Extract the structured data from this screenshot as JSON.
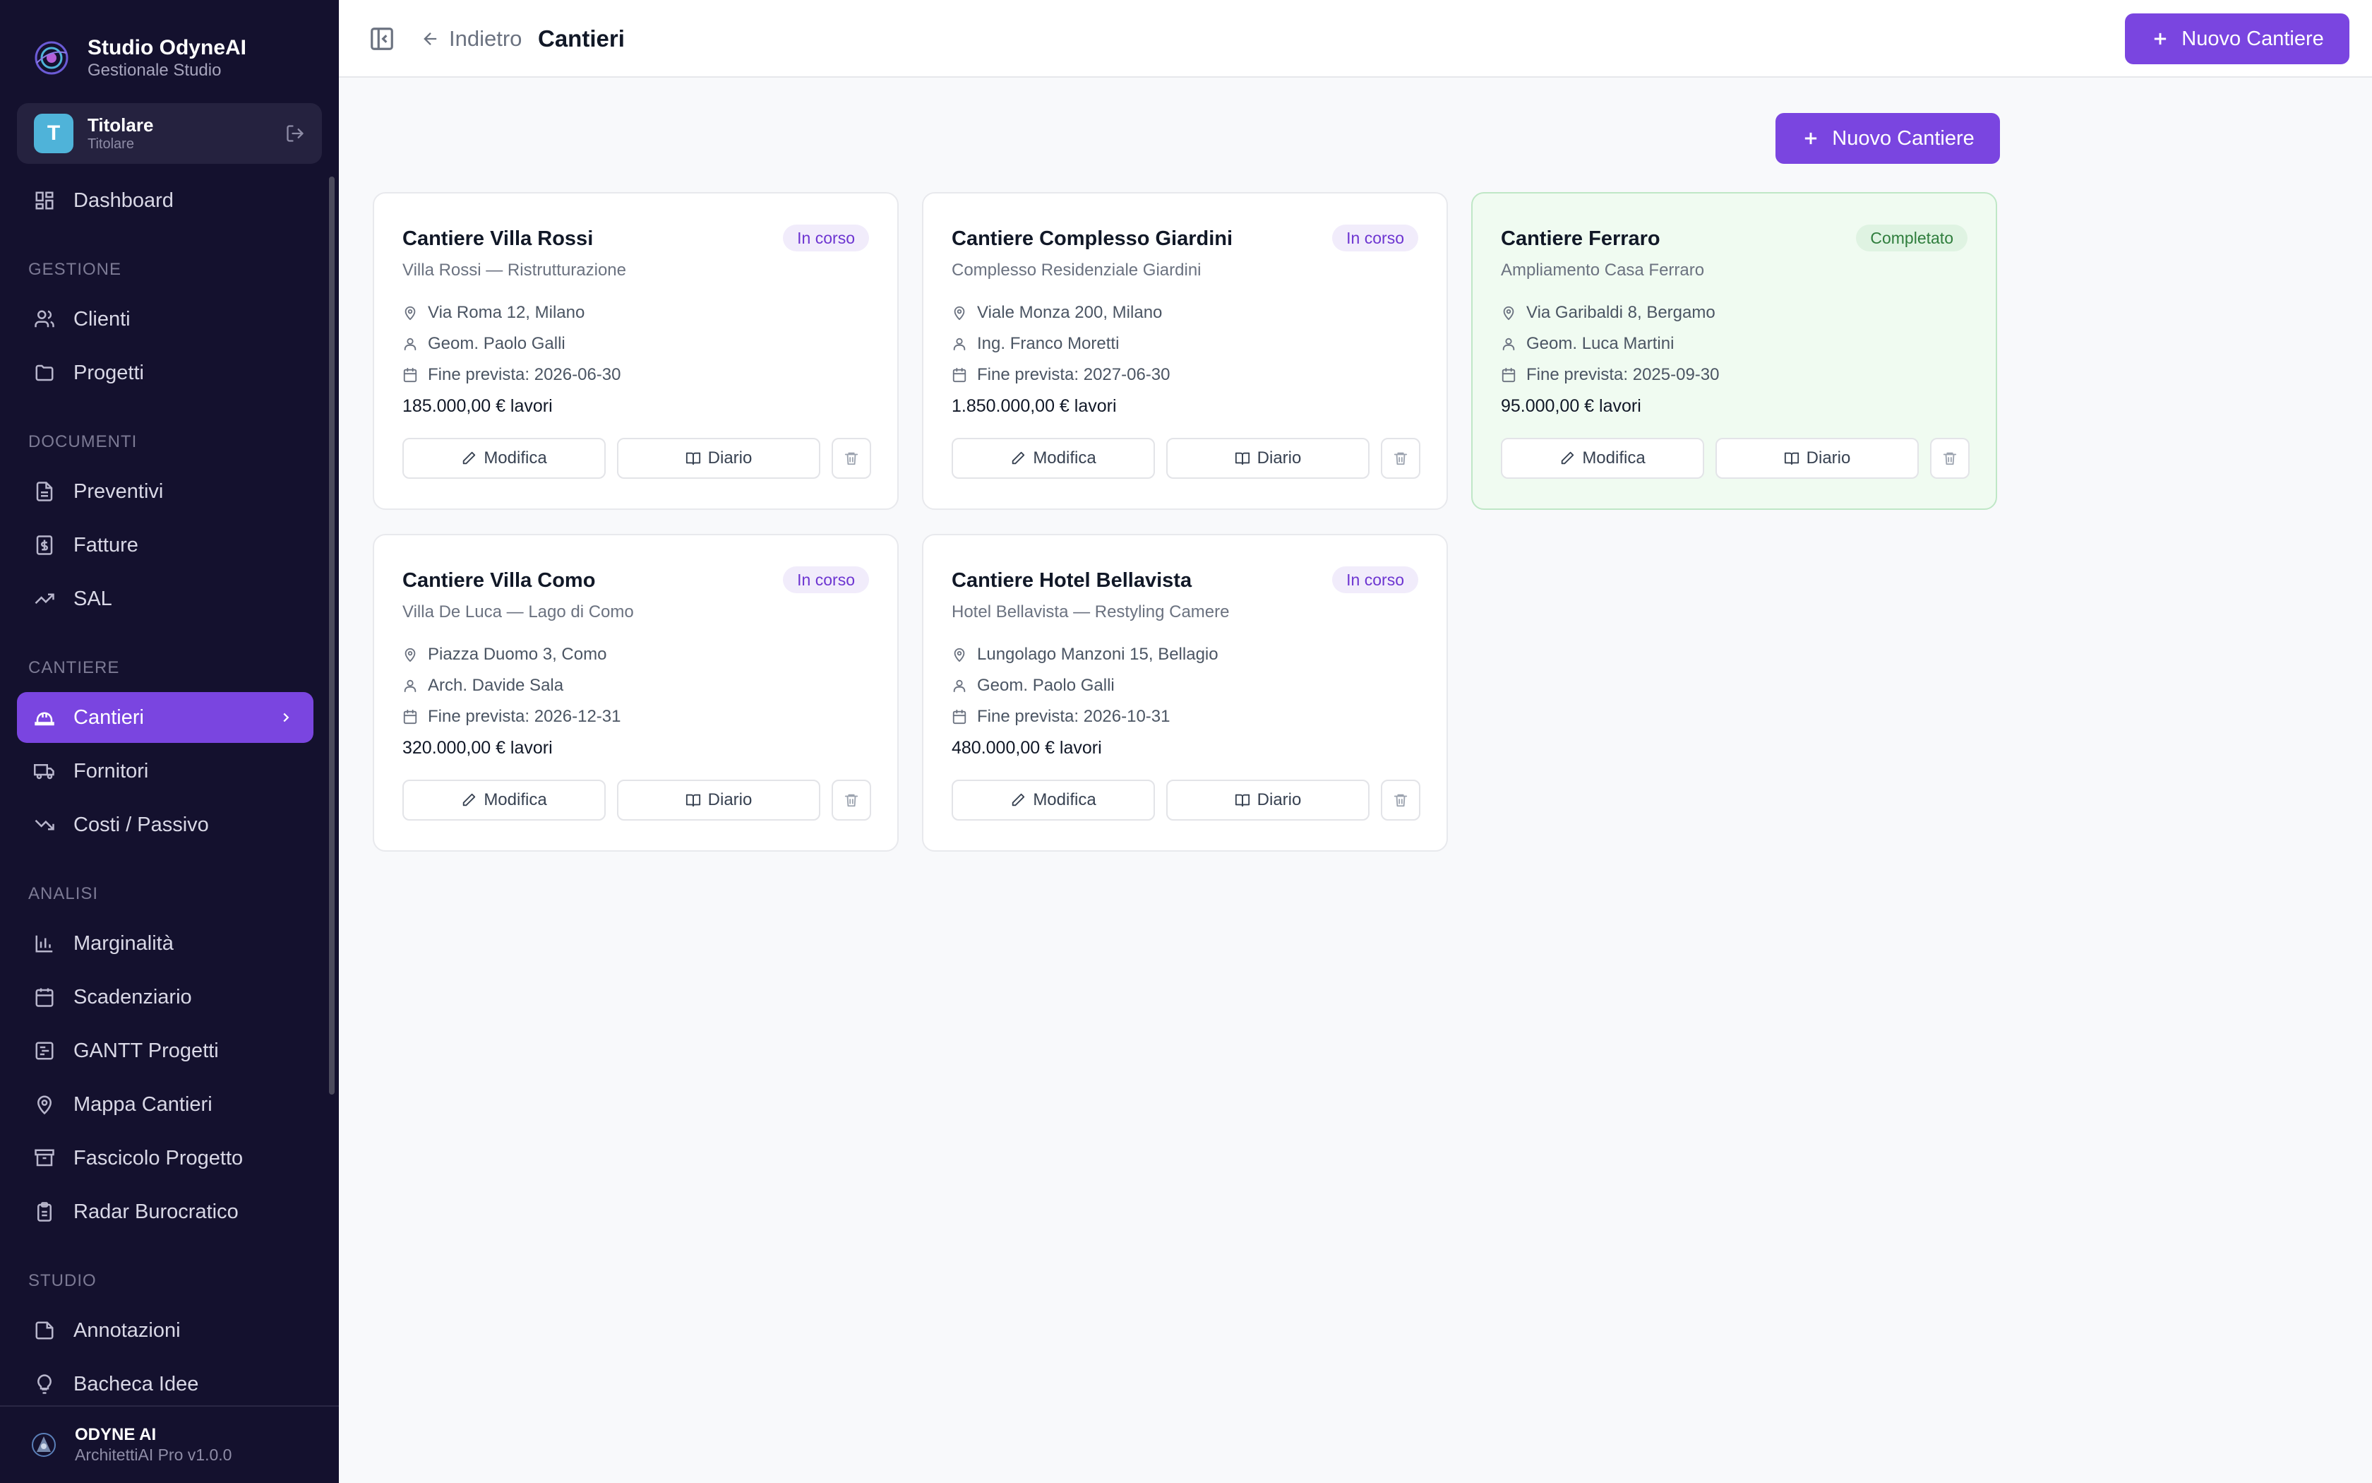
{
  "sidebar": {
    "brand_name": "Studio OdyneAI",
    "brand_sub": "Gestionale Studio",
    "user": {
      "initial": "T",
      "name": "Titolare",
      "role": "Titolare"
    },
    "dashboard": "Dashboard",
    "sections": {
      "gestione": "GESTIONE",
      "documenti": "DOCUMENTI",
      "cantiere": "CANTIERE",
      "analisi": "ANALISI",
      "studio": "STUDIO"
    },
    "items": {
      "clienti": "Clienti",
      "progetti": "Progetti",
      "preventivi": "Preventivi",
      "fatture": "Fatture",
      "sal": "SAL",
      "cantieri": "Cantieri",
      "fornitori": "Fornitori",
      "costi": "Costi / Passivo",
      "marginalita": "Marginalità",
      "scadenziario": "Scadenziario",
      "gantt": "GANTT Progetti",
      "mappa": "Mappa Cantieri",
      "fascicolo": "Fascicolo Progetto",
      "radar": "Radar Burocratico",
      "annotazioni": "Annotazioni",
      "bacheca": "Bacheca Idee"
    },
    "footer": {
      "name": "ODYNE AI",
      "version": "ArchitettiAI Pro v1.0.0"
    }
  },
  "header": {
    "back_label": "Indietro",
    "title": "Cantieri",
    "new_button": "Nuovo Cantiere"
  },
  "main": {
    "new_button": "Nuovo Cantiere",
    "labels": {
      "edit": "Modifica",
      "diary": "Diario"
    },
    "cards": [
      {
        "title": "Cantiere Villa Rossi",
        "status": "In corso",
        "subtitle": "Villa Rossi — Ristrutturazione",
        "address": "Via Roma 12, Milano",
        "manager": "Geom. Paolo Galli",
        "end": "Fine prevista: 2026-06-30",
        "amount": "185.000,00 € lavori"
      },
      {
        "title": "Cantiere Complesso Giardini",
        "status": "In corso",
        "subtitle": "Complesso Residenziale Giardini",
        "address": "Viale Monza 200, Milano",
        "manager": "Ing. Franco Moretti",
        "end": "Fine prevista: 2027-06-30",
        "amount": "1.850.000,00 € lavori"
      },
      {
        "title": "Cantiere Ferraro",
        "status": "Completato",
        "subtitle": "Ampliamento Casa Ferraro",
        "address": "Via Garibaldi 8, Bergamo",
        "manager": "Geom. Luca Martini",
        "end": "Fine prevista: 2025-09-30",
        "amount": "95.000,00 € lavori"
      },
      {
        "title": "Cantiere Villa Como",
        "status": "In corso",
        "subtitle": "Villa De Luca — Lago di Como",
        "address": "Piazza Duomo 3, Como",
        "manager": "Arch. Davide Sala",
        "end": "Fine prevista: 2026-12-31",
        "amount": "320.000,00 € lavori"
      },
      {
        "title": "Cantiere Hotel Bellavista",
        "status": "In corso",
        "subtitle": "Hotel Bellavista — Restyling Camere",
        "address": "Lungolago Manzoni 15, Bellagio",
        "manager": "Geom. Paolo Galli",
        "end": "Fine prevista: 2026-10-31",
        "amount": "480.000,00 € lavori"
      }
    ]
  },
  "colors": {
    "accent": "#7a45e0",
    "sidebar_bg": "#14112e",
    "completed_bg": "#f0fbf1",
    "badge_running": "#6d35d1",
    "badge_done": "#2e7d3c"
  }
}
